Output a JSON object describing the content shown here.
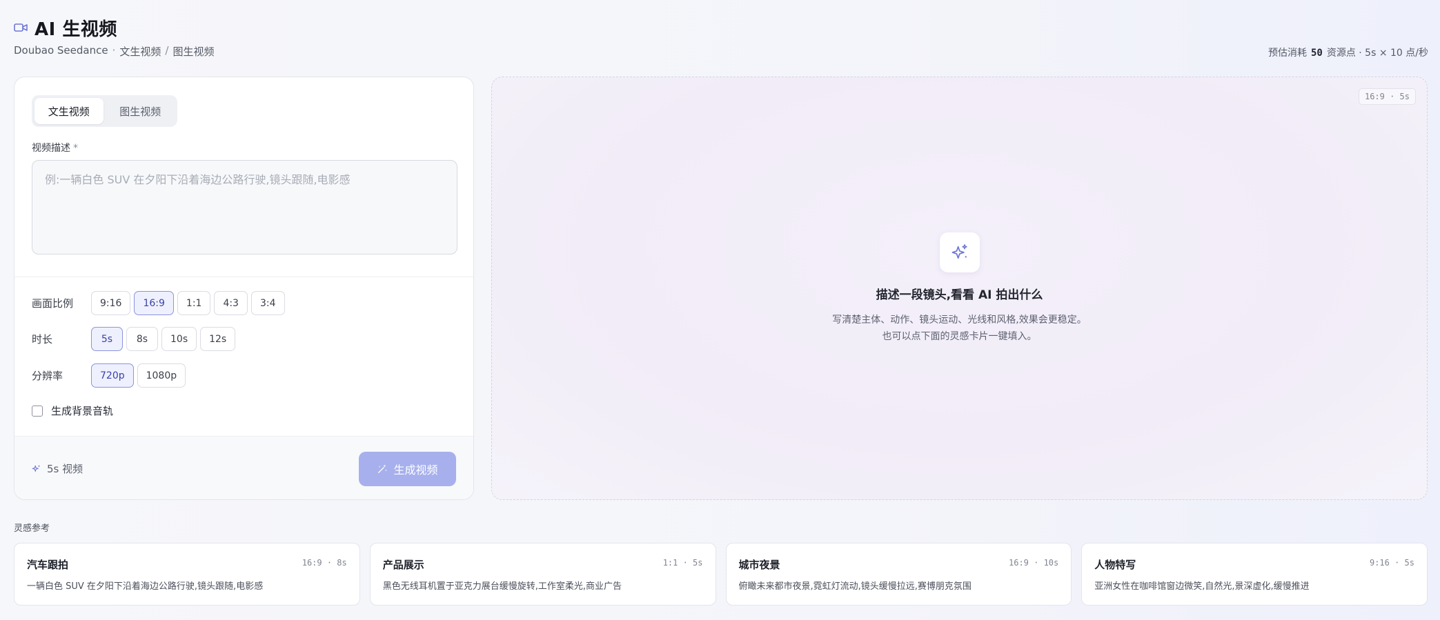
{
  "header": {
    "title": "AI 生视频",
    "breadcrumb": {
      "model": "Doubao Seedance",
      "dot": "·",
      "item1": "文生视频",
      "slash": "/",
      "item2": "图生视频"
    },
    "cost": {
      "prefix": "预估消耗",
      "points": "50",
      "suffix": "资源点 · 5s × 10 点/秒"
    }
  },
  "form": {
    "tabs": [
      {
        "label": "文生视频",
        "active": true
      },
      {
        "label": "图生视频",
        "active": false
      }
    ],
    "prompt": {
      "label": "视频描述",
      "required_mark": "*",
      "placeholder": "例:一辆白色 SUV 在夕阳下沿着海边公路行驶,镜头跟随,电影感",
      "value": ""
    },
    "aspect": {
      "label": "画面比例",
      "options": [
        "9:16",
        "16:9",
        "1:1",
        "4:3",
        "3:4"
      ],
      "selected": "16:9"
    },
    "duration": {
      "label": "时长",
      "options": [
        "5s",
        "8s",
        "10s",
        "12s"
      ],
      "selected": "5s"
    },
    "resolution": {
      "label": "分辨率",
      "options": [
        "720p",
        "1080p"
      ],
      "selected": "720p"
    },
    "bgm": {
      "label": "生成背景音轨",
      "checked": false
    },
    "footer_info": "5s 视频",
    "generate_label": "生成视频"
  },
  "preview": {
    "ratio_tag": "16:9 · 5s",
    "title": "描述一段镜头,看看 AI 拍出什么",
    "desc_line1": "写清楚主体、动作、镜头运动、光线和风格,效果会更稳定。",
    "desc_line2": "也可以点下面的灵感卡片一键填入。"
  },
  "inspiration": {
    "label": "灵感参考",
    "cards": [
      {
        "title": "汽车跟拍",
        "meta": "16:9 · 8s",
        "desc": "一辆白色 SUV 在夕阳下沿着海边公路行驶,镜头跟随,电影感"
      },
      {
        "title": "产品展示",
        "meta": "1:1 · 5s",
        "desc": "黑色无线耳机置于亚克力展台缓慢旋转,工作室柔光,商业广告"
      },
      {
        "title": "城市夜景",
        "meta": "16:9 · 10s",
        "desc": "俯瞰未来都市夜景,霓虹灯流动,镜头缓慢拉远,赛博朋克氛围"
      },
      {
        "title": "人物特写",
        "meta": "9:16 · 5s",
        "desc": "亚洲女性在咖啡馆窗边微笑,自然光,景深虚化,缓慢推进"
      }
    ]
  },
  "colors": {
    "accent": "#8b93dc",
    "accent_text": "#3a42a8",
    "button_disabled": "#a7b0ec"
  },
  "icons": {
    "title": "video-camera-icon",
    "empty": "sparkles-icon",
    "footer": "sparkles-icon",
    "button": "magic-wand-icon"
  }
}
